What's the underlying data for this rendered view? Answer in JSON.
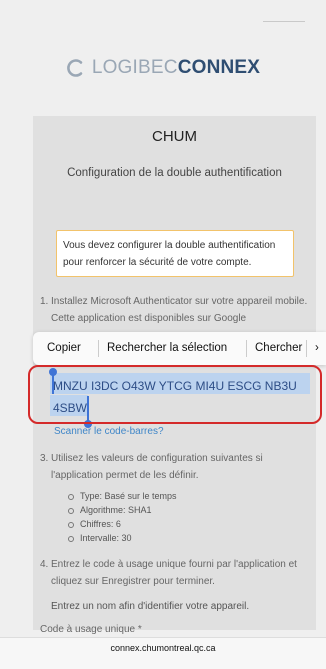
{
  "logo": {
    "light_text": "LOGIBEC",
    "bold_text": "CONNEX",
    "accent_color": "#2f4e72",
    "light_color": "#9aa7b5"
  },
  "panel": {
    "title": "CHUM",
    "subtitle": "Configuration de la double authentification",
    "warning": "Vous devez configurer la double authentification pour renforcer la sécurité de votre compte."
  },
  "steps": {
    "step1_num": "1.",
    "step1_text": "Installez Microsoft Authenticator sur votre appareil mobile. Cette application est disponibles sur Google",
    "step3_num": "3.",
    "step3_text": "Utilisez les valeurs de configuration suivantes si l'application permet de les définir.",
    "config": [
      "Type: Basé sur le temps",
      "Algorithme: SHA1",
      "Chiffres: 6",
      "Intervalle: 30"
    ],
    "step4_num": "4.",
    "step4_text": "Entrez le code à usage unique fourni par l'application et cliquez sur Enregistrer pour terminer.",
    "device_prompt": "Entrez un nom afin d'identifier votre appareil."
  },
  "secret_code": "MNZU I3DC O43W YTCG MI4U ESCG NB3U 4SBW",
  "scan_link": "Scanner le code-barres?",
  "one_time_code_label": "Code à usage unique *",
  "context_menu": {
    "copy": "Copier",
    "search_selection": "Rechercher la sélection",
    "find": "Chercher",
    "more": "›"
  },
  "browser": {
    "url": "connex.chumontreal.qc.ca"
  },
  "colors": {
    "highlight_frame": "#d42a2a",
    "selection": "#bcd3ef",
    "link": "#3f86c8"
  }
}
